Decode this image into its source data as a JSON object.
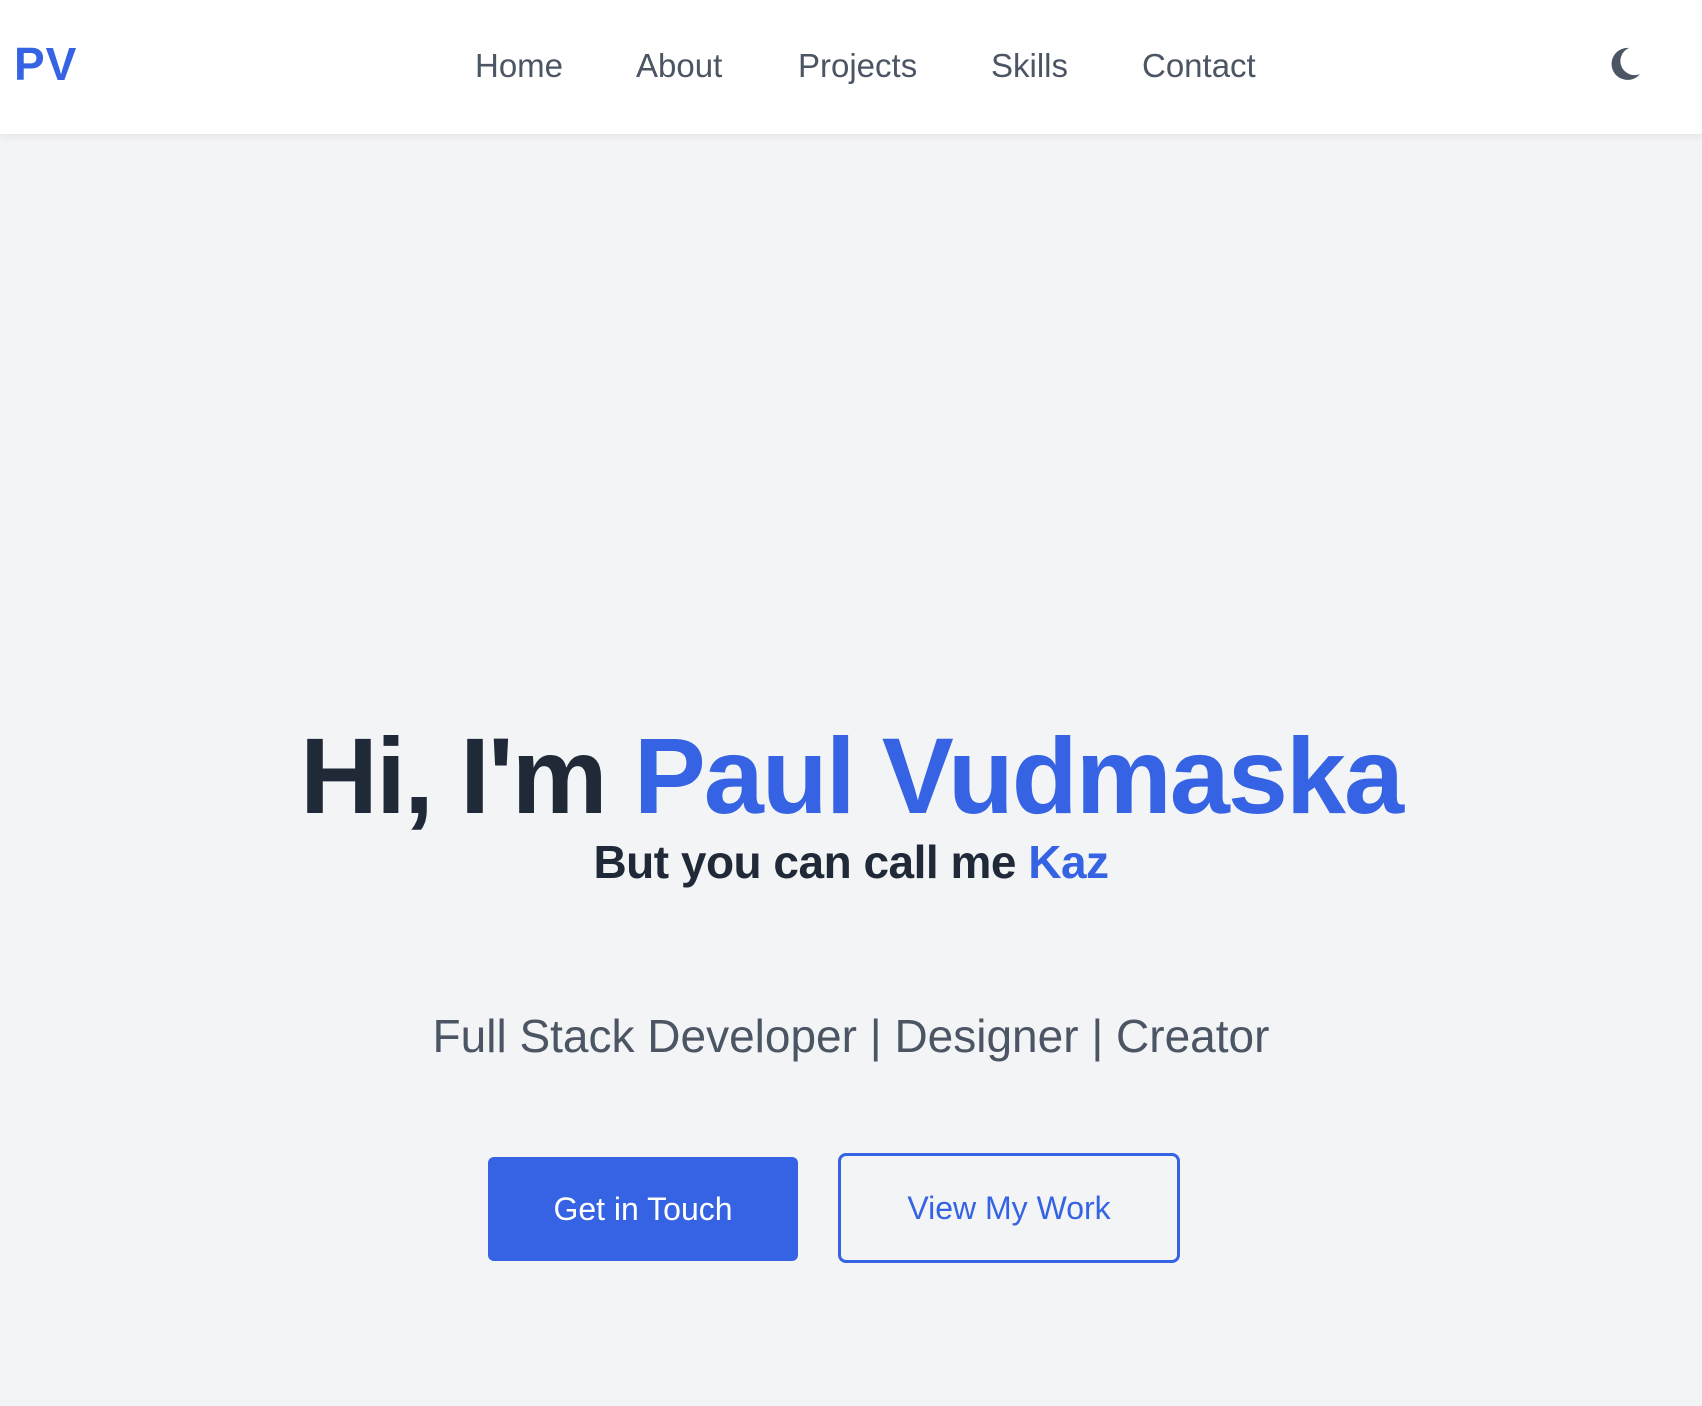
{
  "header": {
    "logo": "PV",
    "nav": [
      {
        "label": "Home"
      },
      {
        "label": "About"
      },
      {
        "label": "Projects"
      },
      {
        "label": "Skills"
      },
      {
        "label": "Contact"
      }
    ],
    "theme_toggle_icon": "moon-icon"
  },
  "hero": {
    "greeting": "Hi, I'm",
    "name": "Paul Vudmaska",
    "sub_prefix": "But you can call me",
    "nickname": "Kaz",
    "tagline": "Full Stack Developer | Designer | Creator",
    "primary_button": "Get in Touch",
    "secondary_button": "View My Work"
  },
  "colors": {
    "accent": "#3563e3",
    "heading": "#1f2937",
    "muted": "#4b5563",
    "background": "#f3f4f6",
    "navbar": "#ffffff"
  }
}
